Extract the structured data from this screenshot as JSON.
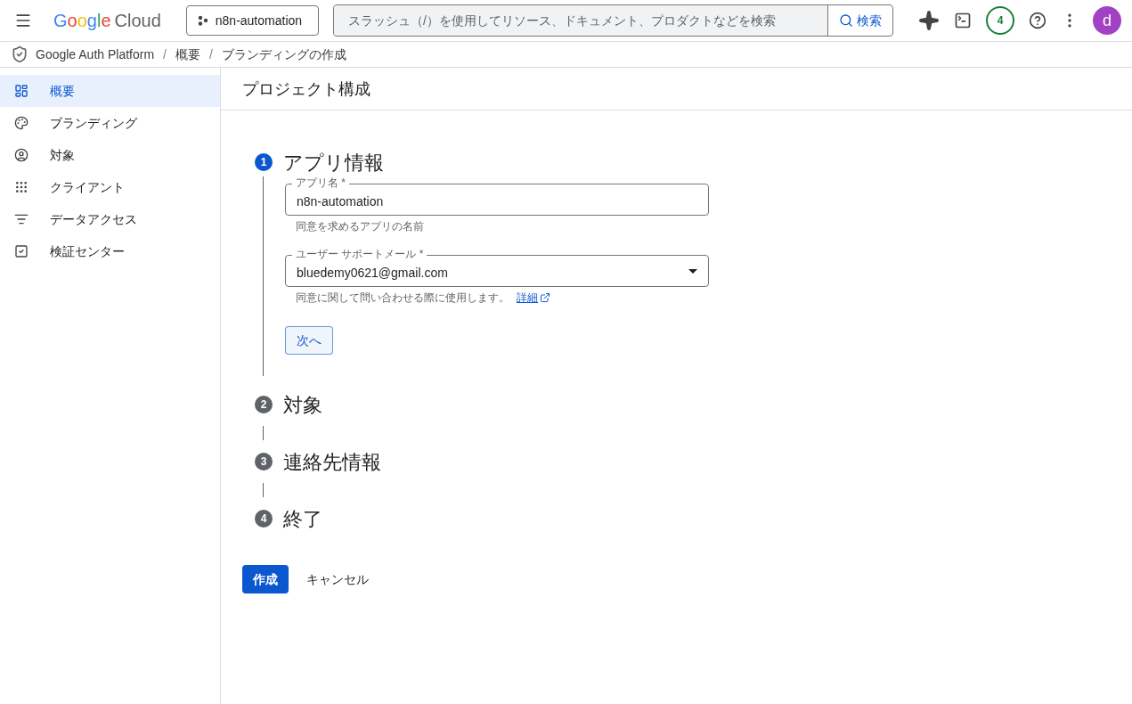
{
  "header": {
    "logo_word": "Google",
    "logo_product": "Cloud",
    "project": "n8n-automation",
    "search": {
      "placeholder": "スラッシュ（/）を使用してリソース、ドキュメント、プロダクトなどを検索",
      "button": "検索"
    },
    "notifications": "4",
    "avatar": "d"
  },
  "breadcrumb": [
    {
      "kind": "link",
      "text": "Google Auth Platform"
    },
    {
      "kind": "separator",
      "text": "/"
    },
    {
      "kind": "link",
      "text": "概要"
    },
    {
      "kind": "separator",
      "text": "/"
    },
    {
      "kind": "link",
      "text": "ブランディングの作成"
    }
  ],
  "sidebar": {
    "items": [
      {
        "label": "概要",
        "selected": true
      },
      {
        "label": "ブランディング",
        "selected": false
      },
      {
        "label": "対象",
        "selected": false
      },
      {
        "label": "クライアント",
        "selected": false
      },
      {
        "label": "データアクセス",
        "selected": false
      },
      {
        "label": "検証センター",
        "selected": false
      }
    ]
  },
  "page_title": "プロジェクト構成",
  "steps": [
    {
      "number": "1",
      "title": "アプリ情報",
      "selected": true,
      "fields": [
        {
          "kind": "text",
          "label": "アプリ名 *",
          "value": "n8n-automation",
          "hint": "同意を求めるアプリの名前"
        },
        {
          "kind": "select",
          "label": "ユーザー サポートメール *",
          "value": "bluedemy0621@gmail.com",
          "hint": "同意に関して問い合わせる際に使用します。",
          "link": "詳細"
        }
      ],
      "next_button": "次へ"
    },
    {
      "number": "2",
      "title": "対象",
      "selected": false
    },
    {
      "number": "3",
      "title": "連絡先情報",
      "selected": false
    },
    {
      "number": "4",
      "title": "終了",
      "selected": false
    }
  ],
  "actions": {
    "primary": "作成",
    "secondary": "キャンセル"
  }
}
